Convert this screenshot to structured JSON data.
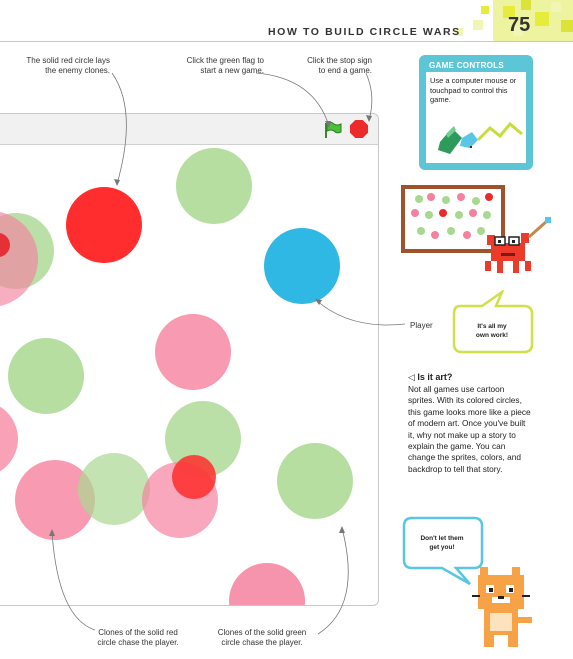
{
  "header": {
    "title": "HOW TO BUILD CIRCLE WARS",
    "page_number": "75"
  },
  "annotations": {
    "red_circle": "The solid red circle lays the enemy clones.",
    "green_flag": "Click the green flag to start a new game.",
    "stop_sign": "Click the stop sign to end a game.",
    "player": "Player",
    "red_clones": "Clones of the solid red circle chase the player.",
    "green_clones": "Clones of the solid green circle chase the player."
  },
  "game_controls": {
    "title": "GAME CONTROLS",
    "text": "Use a computer mouse or touchpad to control this game."
  },
  "bubbles": {
    "my_work": "It's all my own work!",
    "dont_let": "Don't let them get you!"
  },
  "sidebar": {
    "heading": "Is it art?",
    "heading_icon": "left-pointing-triangle-icon",
    "body": "Not all games use cartoon sprites. With its colored circles, this game looks more like a piece of modern art. Once you've built it, why not make up a story to explain the game. You can change the sprites, colors, and backdrop to tell that story."
  },
  "colors": {
    "accent_teal": "#5cc6d6",
    "header_yellow": "#e5ec3a",
    "player_blue": "#2fb8e3",
    "enemy_red": "#ff2d2d",
    "clone_red": "#f5819f",
    "clone_green": "#a9d891"
  }
}
